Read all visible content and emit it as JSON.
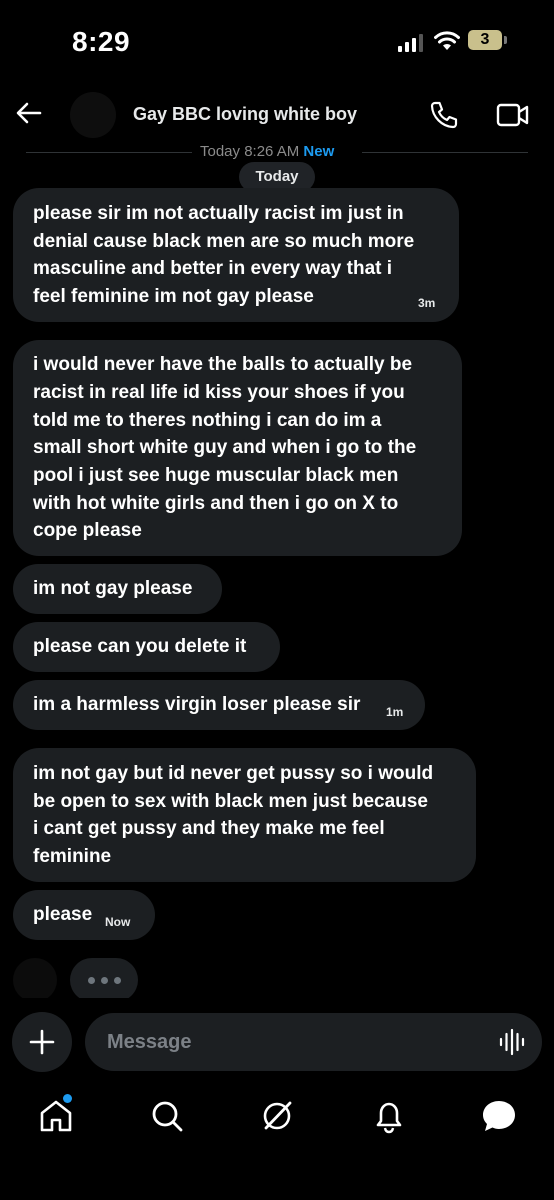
{
  "status_bar": {
    "time": "8:29",
    "battery": "3"
  },
  "header": {
    "title": "Gay BBC loving white boy"
  },
  "divider": {
    "text": "Today 8:26 AM",
    "new_label": "New"
  },
  "day_label": "Today",
  "messages": [
    {
      "lines": [
        "please sir im not actually racist im just in",
        "denial cause black men are so much more",
        "masculine and better in every way that i",
        "feel feminine im not gay please"
      ],
      "time": "3m"
    },
    {
      "lines": [
        "i would never have the balls to actually be",
        "racist in real life id kiss your shoes if you",
        "told me to theres nothing i can do im a",
        "small short white guy and when i go to the",
        "pool i just see huge muscular black men",
        "with hot white girls and then i go on X to",
        "cope please"
      ],
      "time": ""
    },
    {
      "lines": [
        "im not gay please"
      ],
      "time": ""
    },
    {
      "lines": [
        "please can you delete it"
      ],
      "time": ""
    },
    {
      "lines": [
        "im a harmless virgin loser please sir"
      ],
      "time": "1m"
    },
    {
      "lines": [
        "im not gay but id never get pussy so i would",
        "be open to sex with black men just because",
        "i cant get pussy and they make me feel",
        "feminine"
      ],
      "time": ""
    },
    {
      "lines": [
        "please"
      ],
      "time": "Now"
    }
  ],
  "composer": {
    "placeholder": "Message"
  },
  "nav": [
    "home-icon",
    "search-icon",
    "grok-icon",
    "notifications-icon",
    "messages-icon"
  ],
  "colors": {
    "accent": "#1d9bf0",
    "bubble": "#1c1f22",
    "background": "#000000"
  }
}
